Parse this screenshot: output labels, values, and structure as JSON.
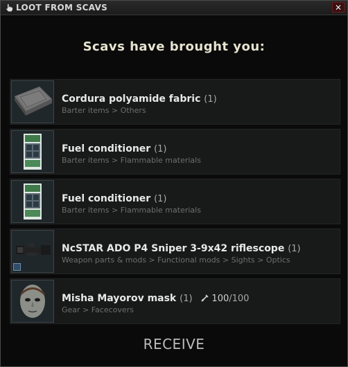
{
  "window": {
    "title": "LOOT FROM SCAVS",
    "close": "✕"
  },
  "heading": "Scavs have brought you:",
  "items": [
    {
      "name": "Cordura polyamide fabric",
      "count": "(1)",
      "category": "Barter items > Others",
      "icon": "fabric-icon"
    },
    {
      "name": "Fuel conditioner",
      "count": "(1)",
      "category": "Barter items > Flammable materials",
      "icon": "fuel-conditioner-icon"
    },
    {
      "name": "Fuel conditioner",
      "count": "(1)",
      "category": "Barter items > Flammable materials",
      "icon": "fuel-conditioner-icon"
    },
    {
      "name": "NcSTAR ADO P4 Sniper 3-9x42 riflescope",
      "count": "(1)",
      "category": "Weapon parts & mods > Functional mods > Sights > Optics",
      "icon": "riflescope-icon"
    },
    {
      "name": "Misha Mayorov mask",
      "count": "(1)",
      "category": "Gear > Facecovers",
      "icon": "mask-icon",
      "durability": {
        "current": "100",
        "max": "/100"
      }
    }
  ],
  "receive_label": "RECEIVE"
}
